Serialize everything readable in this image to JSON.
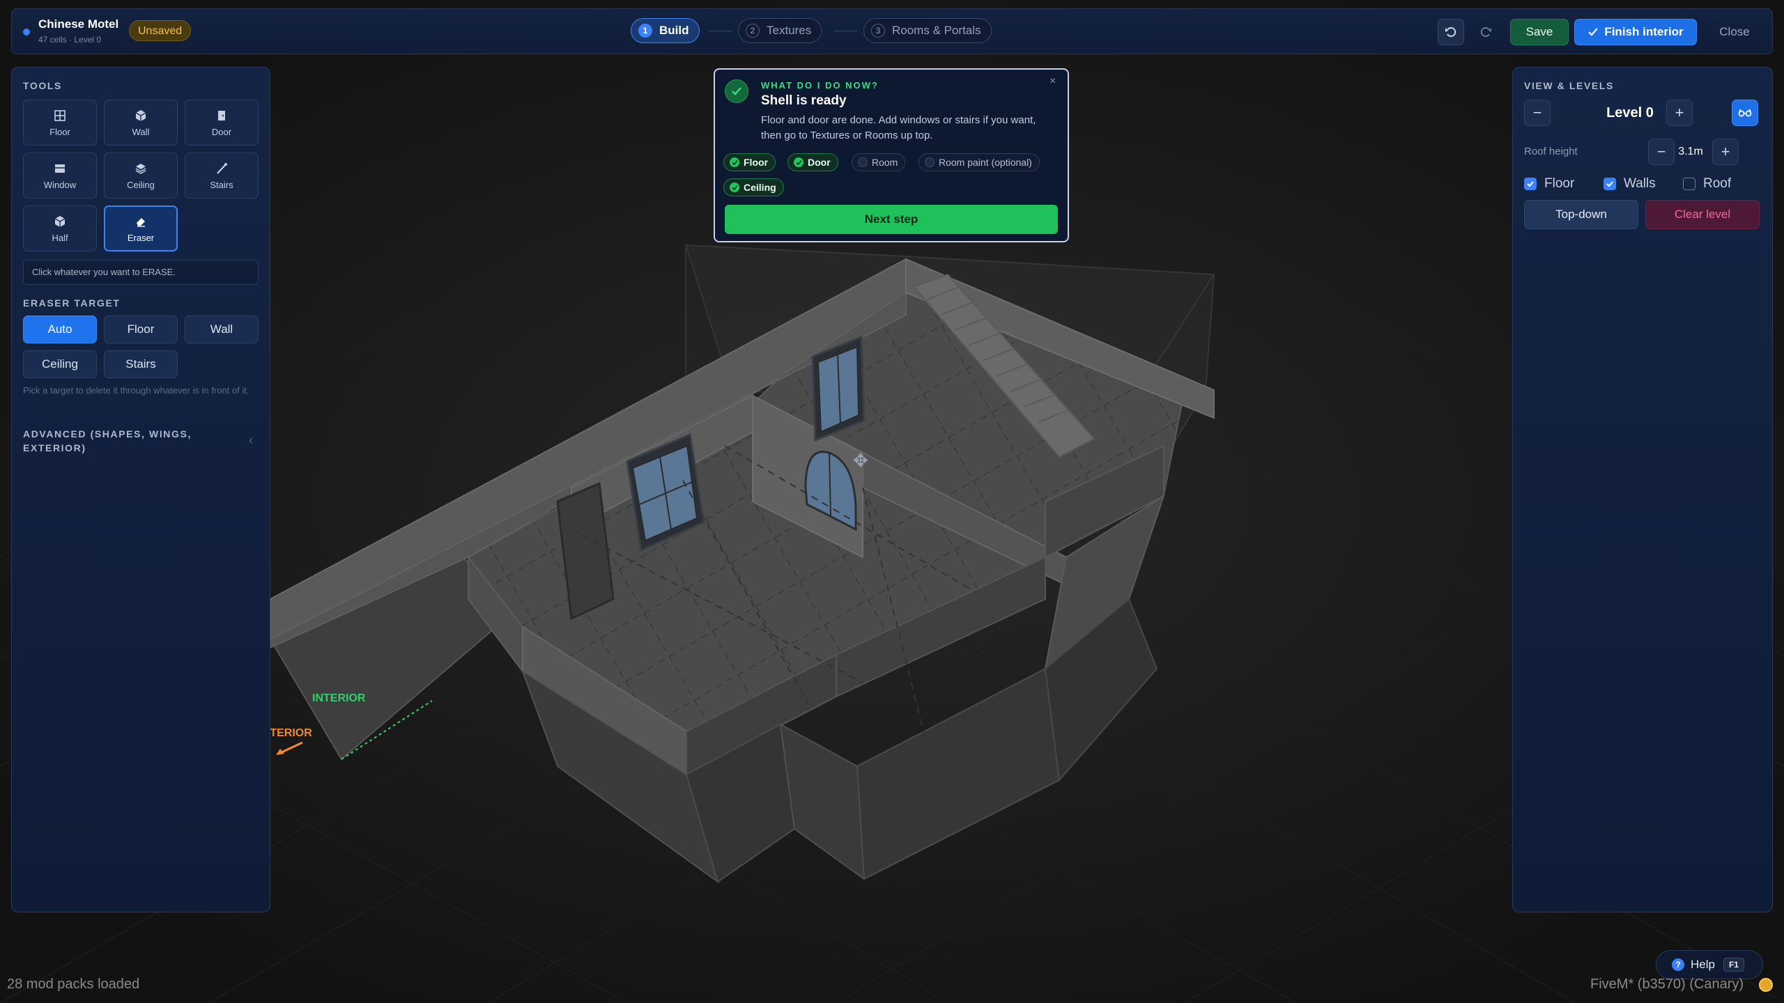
{
  "app": {
    "project_name": "Chinese Motel",
    "project_meta": "47 cells · Level 0",
    "unsaved_badge": "Unsaved"
  },
  "steps": [
    {
      "num": "1",
      "label": "Build",
      "active": true
    },
    {
      "num": "2",
      "label": "Textures",
      "active": false
    },
    {
      "num": "3",
      "label": "Rooms & Portals",
      "active": false
    }
  ],
  "toolbar": {
    "undo_icon": "undo-icon",
    "redo_icon": "redo-icon",
    "save_label": "Save",
    "finish_label": "Finish interior",
    "close_label": "Close"
  },
  "tools_panel": {
    "title": "TOOLS",
    "tools": [
      {
        "label": "Floor",
        "icon": "grid-icon",
        "active": false
      },
      {
        "label": "Wall",
        "icon": "cube-icon",
        "active": false
      },
      {
        "label": "Door",
        "icon": "door-icon",
        "active": false
      },
      {
        "label": "Window",
        "icon": "window-icon",
        "active": false
      },
      {
        "label": "Ceiling",
        "icon": "layers-icon",
        "active": false
      },
      {
        "label": "Stairs",
        "icon": "stairs-icon",
        "active": false
      },
      {
        "label": "Half",
        "icon": "half-cube-icon",
        "active": false
      },
      {
        "label": "Eraser",
        "icon": "eraser-icon",
        "active": true
      }
    ],
    "hint": "Click whatever you want to ERASE.",
    "eraser_target_title": "ERASER TARGET",
    "eraser_targets": [
      {
        "label": "Auto",
        "active": true
      },
      {
        "label": "Floor",
        "active": false
      },
      {
        "label": "Wall",
        "active": false
      },
      {
        "label": "Ceiling",
        "active": false
      },
      {
        "label": "Stairs",
        "active": false
      }
    ],
    "eraser_note": "Pick a target to delete it through whatever is in front of it.",
    "advanced_title": "ADVANCED (SHAPES, WINGS, EXTERIOR)"
  },
  "wizard": {
    "kicker": "WHAT DO I DO NOW?",
    "title": "Shell is ready",
    "description": "Floor and door are done. Add windows or stairs if you want, then go to Textures or Rooms up top.",
    "close_symbol": "×",
    "checklist": [
      {
        "label": "Floor",
        "done": true
      },
      {
        "label": "Door",
        "done": true
      },
      {
        "label": "Room",
        "done": false
      },
      {
        "label": "Room paint (optional)",
        "done": false
      },
      {
        "label": "Ceiling",
        "done": true
      }
    ],
    "next_label": "Next step"
  },
  "view_panel": {
    "title": "VIEW & LEVELS",
    "level_label": "Level 0",
    "minus_symbol": "−",
    "plus_symbol": "+",
    "roof_height_label": "Roof height",
    "roof_height_value": "3.1m",
    "toggles": [
      {
        "label": "Floor",
        "checked": true
      },
      {
        "label": "Walls",
        "checked": true
      },
      {
        "label": "Roof",
        "checked": false
      }
    ],
    "topdown_label": "Top-down",
    "clear_label": "Clear level"
  },
  "scene": {
    "interior_label": "INTERIOR",
    "exterior_label": "EXTERIOR",
    "cursor_symbol": "✥"
  },
  "footer": {
    "mods_status": "28 mod packs loaded",
    "help_label": "Help",
    "help_key": "F1",
    "build_info": "FiveM* (b3570) (Canary)"
  },
  "colors": {
    "accent_blue": "#3b82f6",
    "success_green": "#22c55e",
    "warning_amber": "#f5c14a",
    "danger_pink": "#f06a9e",
    "interior_green": "#2ed16a",
    "exterior_orange": "#f08a2c"
  }
}
